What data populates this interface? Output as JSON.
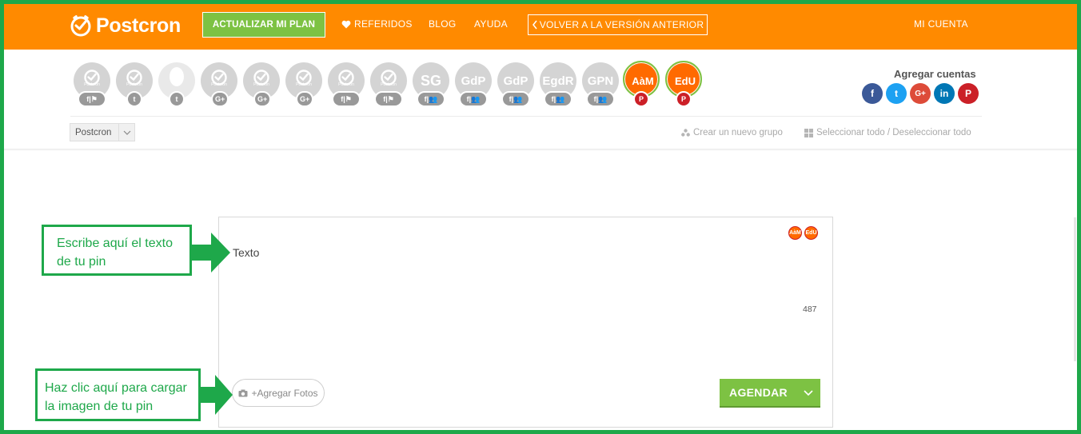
{
  "nav": {
    "logo_text": "Postcron",
    "plan_button": "ACTUALIZAR MI PLAN",
    "referrals": "REFERIDOS",
    "blog": "BLOG",
    "help": "AYUDA",
    "old_version": "VOLVER A LA VERSIÓN ANTERIOR",
    "account": "MI CUENTA",
    "brand_color": "#ff8a00",
    "accent_color": "#7dc243"
  },
  "accounts": [
    {
      "type": "postcron",
      "caption": "Postcron",
      "badge": "f|⚑"
    },
    {
      "type": "postcron",
      "caption": "Postcron",
      "badge": "t"
    },
    {
      "type": "ghost",
      "badge": "t"
    },
    {
      "type": "postcron",
      "caption": "Postcron",
      "badge": "G+"
    },
    {
      "type": "postcron",
      "caption": "Postcron",
      "badge": "G+"
    },
    {
      "type": "postcron",
      "caption": "Postcron",
      "badge": "G+"
    },
    {
      "type": "postcron",
      "caption": "Postcron",
      "badge": "f|⚑"
    },
    {
      "type": "postcron",
      "caption": "Postcron",
      "badge": "f|⚑"
    },
    {
      "type": "text",
      "label": "SG",
      "badge": "f|👥"
    },
    {
      "type": "text",
      "label": "GdP",
      "badge": "f|👥"
    },
    {
      "type": "text",
      "label": "GdP",
      "badge": "f|👥"
    },
    {
      "type": "text",
      "label": "EgdR",
      "badge": "f|👥"
    },
    {
      "type": "text",
      "label": "GPN",
      "badge": "f|👥"
    },
    {
      "type": "active",
      "label": "AàM",
      "badge": "P"
    },
    {
      "type": "active",
      "label": "EdU",
      "badge": "P"
    }
  ],
  "add_accounts": {
    "title": "Agregar cuentas",
    "networks": [
      {
        "name": "facebook-icon",
        "glyph": "f"
      },
      {
        "name": "twitter-icon",
        "glyph": "t"
      },
      {
        "name": "google-plus-icon",
        "glyph": "G+"
      },
      {
        "name": "linkedin-icon",
        "glyph": "in"
      },
      {
        "name": "pinterest-icon",
        "glyph": "P"
      }
    ]
  },
  "groups": {
    "selected": "Postcron",
    "create_group": "Crear un nuevo grupo",
    "select_all": "Seleccionar todo / Deseleccionar todo"
  },
  "composer": {
    "selected_avatars": [
      "AàM",
      "EdU"
    ],
    "placeholder": "Texto",
    "char_count": "487",
    "add_photos": "+Agregar Fotos",
    "schedule": "AGENDAR"
  },
  "annotations": {
    "text_hint_line1": "Escribe aquí el texto",
    "text_hint_line2": "de tu pin",
    "photo_hint_line1": "Haz clic aquí para cargar",
    "photo_hint_line2": "la imagen de tu pin",
    "color": "#1ea84a"
  }
}
